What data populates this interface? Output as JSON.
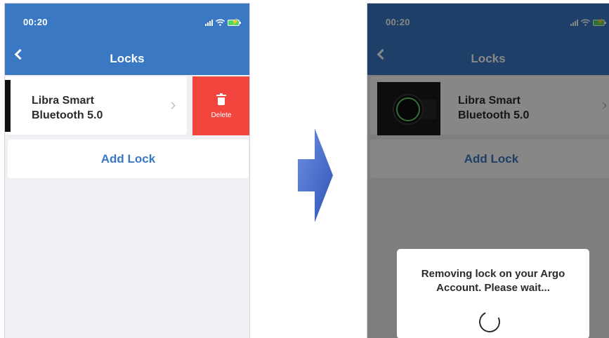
{
  "status": {
    "time": "00:20"
  },
  "nav": {
    "title": "Locks",
    "back_icon": "chevron-left-icon"
  },
  "lock_row": {
    "name_line1": "Libra Smart",
    "name_line2": "Bluetooth 5.0"
  },
  "delete_action": {
    "label": "Delete",
    "icon": "trash-icon"
  },
  "add_lock": {
    "label": "Add Lock"
  },
  "dialog": {
    "message_line1": "Removing lock on your Argo",
    "message_line2": "Account. Please wait..."
  },
  "colors": {
    "nav": "#3a78c3",
    "delete": "#f2453d",
    "accent": "#3a78c3",
    "battery": "#4cd964",
    "arrow": "#4a6fd0"
  }
}
